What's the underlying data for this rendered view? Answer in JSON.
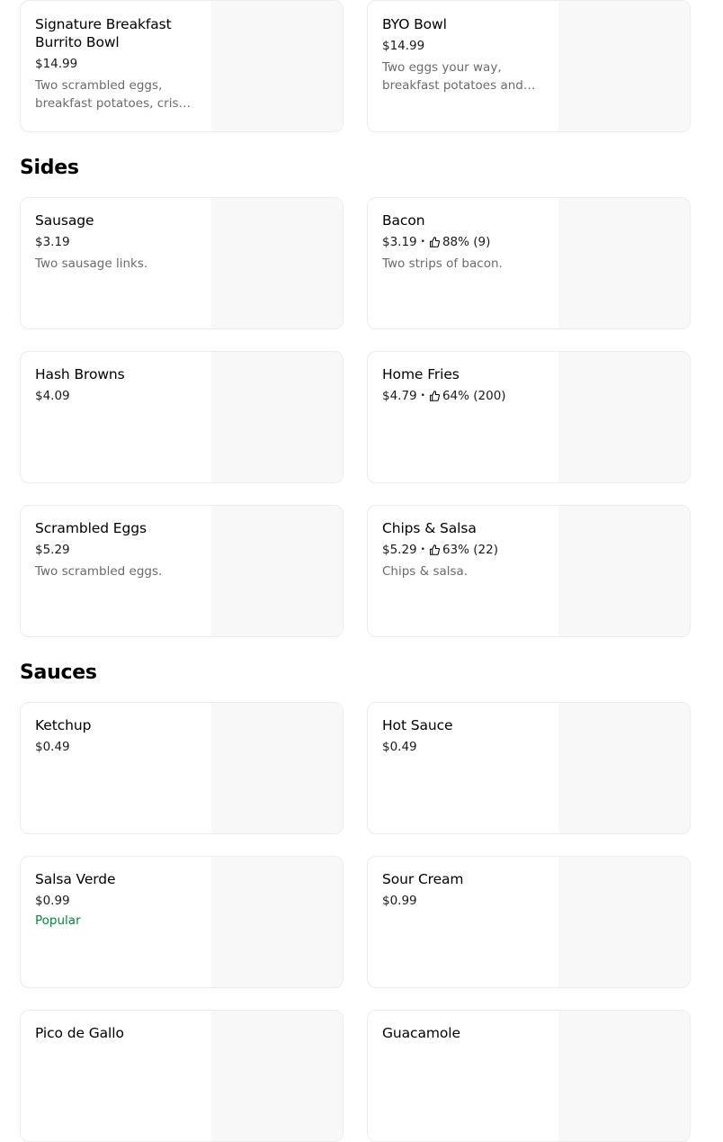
{
  "sections": {
    "sides": "Sides",
    "sauces": "Sauces"
  },
  "items": {
    "signature_burrito_bowl": {
      "name": "Signature Breakfast Burrito Bowl",
      "price": "$14.99",
      "description": "Two scrambled eggs, breakfast potatoes, crispy bacon and more"
    },
    "byo_bowl": {
      "name": "BYO Bowl",
      "price": "$14.99",
      "description": "Two eggs your way, breakfast potatoes and your choice of toppings"
    },
    "sausage": {
      "name": "Sausage",
      "price": "$3.19",
      "description": "Two sausage links."
    },
    "bacon": {
      "name": "Bacon",
      "price": "$3.19",
      "rating": "88% (9)",
      "description": "Two strips of bacon."
    },
    "hash_browns": {
      "name": "Hash Browns",
      "price": "$4.09"
    },
    "home_fries": {
      "name": "Home Fries",
      "price": "$4.79",
      "rating": "64% (200)"
    },
    "scrambled_eggs": {
      "name": "Scrambled Eggs",
      "price": "$5.29",
      "description": "Two scrambled eggs."
    },
    "chips_salsa": {
      "name": "Chips & Salsa",
      "price": "$5.29",
      "rating": "63% (22)",
      "description": "Chips & salsa."
    },
    "ketchup": {
      "name": "Ketchup",
      "price": "$0.49"
    },
    "hot_sauce": {
      "name": "Hot Sauce",
      "price": "$0.49"
    },
    "salsa_verde": {
      "name": "Salsa Verde",
      "price": "$0.99",
      "badge": "Popular"
    },
    "sour_cream": {
      "name": "Sour Cream",
      "price": "$0.99"
    },
    "pico_de_gallo": {
      "name": "Pico de Gallo"
    },
    "guacamole": {
      "name": "Guacamole"
    }
  },
  "separator": "•",
  "icons": {
    "rating": "thumbs-up-icon"
  },
  "colors": {
    "popular_badge": "#0e8345",
    "description_text": "#6b6b6b",
    "image_placeholder": "#f8f8f8"
  }
}
